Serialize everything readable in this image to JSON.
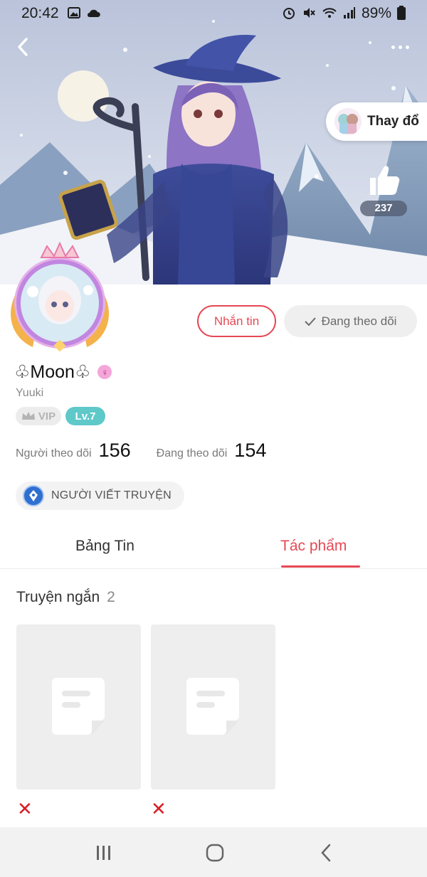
{
  "status_bar": {
    "time": "20:42",
    "battery": "89%",
    "icons": [
      "image-icon",
      "cloud-sync-icon",
      "alarm-icon",
      "mute-icon",
      "wifi-icon",
      "signal-icon",
      "battery-icon"
    ]
  },
  "banner": {
    "change_label": "Thay đổ",
    "like_count": "237"
  },
  "actions": {
    "message_label": "Nhắn tin",
    "following_label": "Đang theo dõi"
  },
  "profile": {
    "name": "♧Moon♧",
    "handle": "Yuuki",
    "vip_label": "VIP",
    "level_label": "Lv.7",
    "followers_label": "Người theo dõi",
    "followers_count": "156",
    "following_label": "Đang theo dõi",
    "following_count": "154",
    "writer_tag": "NGƯỜI VIẾT TRUYỆN"
  },
  "tabs": {
    "feed": "Bảng Tin",
    "works": "Tác phẩm",
    "active": "works"
  },
  "works": {
    "section_title": "Truyện ngắn",
    "count": "2"
  },
  "colors": {
    "accent": "#e54855",
    "level_badge": "#5fc8c9",
    "delete_mark": "#d61f26"
  }
}
